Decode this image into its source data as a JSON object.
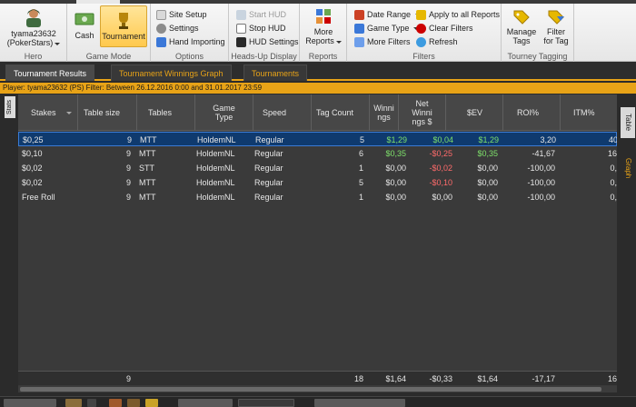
{
  "colors": {
    "accent": "#e8a317",
    "selected_row": "#0f3a6e",
    "positive": "#7ee06b",
    "negative": "#ff6b6b"
  },
  "ribbon": {
    "hero": {
      "name": "tyama23632",
      "site": "(PokerStars)",
      "label": "Hero"
    },
    "game_mode": {
      "cash": "Cash",
      "tournament": "Tournament",
      "label": "Game Mode"
    },
    "options": {
      "site_setup": "Site Setup",
      "settings": "Settings",
      "hand_importing": "Hand Importing",
      "label": "Options"
    },
    "hud": {
      "start_hud": "Start HUD",
      "stop_hud": "Stop HUD",
      "hud_settings": "HUD Settings",
      "label": "Heads-Up Display"
    },
    "reports": {
      "more_reports_1": "More",
      "more_reports_2": "Reports",
      "label": "Reports"
    },
    "filters": {
      "date_range": "Date Range",
      "game_type": "Game Type",
      "more_filters": "More Filters",
      "apply_all": "Apply to all Reports",
      "clear_filters": "Clear Filters",
      "refresh": "Refresh",
      "label": "Filters"
    },
    "tagging": {
      "manage_1": "Manage",
      "manage_2": "Tags",
      "filter_1": "Filter",
      "filter_2": "for Tag",
      "label": "Tourney Tagging"
    }
  },
  "doc_tabs": [
    "Tournament Results",
    "Tournament Winnings Graph",
    "Tournaments"
  ],
  "filter_bar": "Player: tyama23632 (PS)   Filter: Between 26.12.2016 0:00 and 31.01.2017 23:59",
  "side": {
    "stats": "Stats",
    "table": "Table",
    "graph": "Graph"
  },
  "columns": {
    "stakes": "Stakes",
    "table_size": "Table size",
    "tables": "Tables",
    "game_type_1": "Game",
    "game_type_2": "Type",
    "speed": "Speed",
    "tag_count": "Tag Count",
    "winnings_1": "Winni",
    "winnings_2": "ngs",
    "net_1": "Net",
    "net_2": "Winni",
    "net_3": "ngs $",
    "ev": "$EV",
    "roi": "ROI%",
    "itm": "ITM%"
  },
  "rows": [
    {
      "stakes": "$0,25",
      "table_size": "9",
      "tables": "MTT",
      "game_type": "HoldemNL",
      "speed": "Regular",
      "tag_count": "5",
      "winnings": "$1,29",
      "net": "$0,04",
      "ev": "$1,29",
      "roi": "3,20",
      "itm": "40"
    },
    {
      "stakes": "$0,10",
      "table_size": "9",
      "tables": "MTT",
      "game_type": "HoldemNL",
      "speed": "Regular",
      "tag_count": "6",
      "winnings": "$0,35",
      "net": "-$0,25",
      "ev": "$0,35",
      "roi": "-41,67",
      "itm": "16"
    },
    {
      "stakes": "$0,02",
      "table_size": "9",
      "tables": "STT",
      "game_type": "HoldemNL",
      "speed": "Regular",
      "tag_count": "1",
      "winnings": "$0,00",
      "net": "-$0,02",
      "ev": "$0,00",
      "roi": "-100,00",
      "itm": "0,"
    },
    {
      "stakes": "$0,02",
      "table_size": "9",
      "tables": "MTT",
      "game_type": "HoldemNL",
      "speed": "Regular",
      "tag_count": "5",
      "winnings": "$0,00",
      "net": "-$0,10",
      "ev": "$0,00",
      "roi": "-100,00",
      "itm": "0,"
    },
    {
      "stakes": "Free Roll",
      "table_size": "9",
      "tables": "MTT",
      "game_type": "HoldemNL",
      "speed": "Regular",
      "tag_count": "1",
      "winnings": "$0,00",
      "net": "$0,00",
      "ev": "$0,00",
      "roi": "-100,00",
      "itm": "0,"
    }
  ],
  "totals": {
    "table_size": "9",
    "tag_count": "18",
    "winnings": "$1,64",
    "net": "-$0,33",
    "ev": "$1,64",
    "roi": "-17,17",
    "itm": "16"
  }
}
